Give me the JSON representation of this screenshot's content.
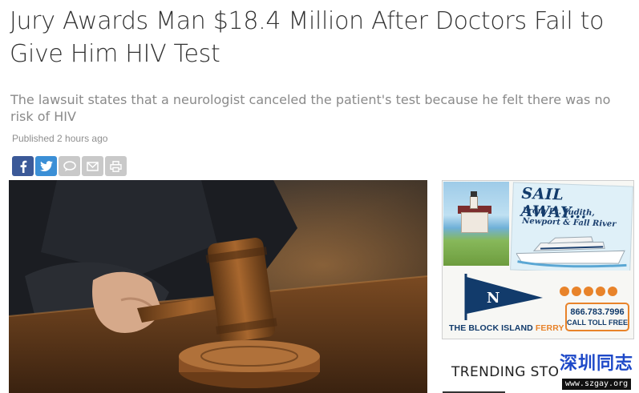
{
  "article": {
    "headline": "Jury Awards Man $18.4 Million After Doctors Fail to Give Him HIV Test",
    "subheadline": "The lawsuit states that a neurologist canceled the patient's test because he felt there was no risk of HIV",
    "published": "Published 2 hours ago"
  },
  "share_bar": {
    "buttons": [
      {
        "name": "facebook",
        "icon": "facebook-icon",
        "color": "#3b5998"
      },
      {
        "name": "twitter",
        "icon": "twitter-icon",
        "color": "#3b8fd6"
      },
      {
        "name": "comments",
        "icon": "comment-icon",
        "color": "#c9c9c9"
      },
      {
        "name": "email",
        "icon": "envelope-icon",
        "color": "#c9c9c9"
      },
      {
        "name": "print",
        "icon": "printer-icon",
        "color": "#c9c9c9"
      }
    ]
  },
  "hero_image": {
    "subject": "gavel-photo",
    "icon": "gavel-image"
  },
  "ad": {
    "headline": "SAIL AWAY...",
    "route": "From Pt. Judith, Newport & Fall River",
    "phone": "866.783.7996",
    "tollfree": "CALL TOLL FREE",
    "brand_main": "THE BLOCK ISLAND",
    "brand_accent": "FERRY",
    "accent_color": "#e8832a",
    "brand_color": "#123b6b"
  },
  "sidebar": {
    "trending_title": "TRENDING STO"
  },
  "watermark": {
    "chinese": "深圳同志",
    "url": "www.szgay.org"
  }
}
